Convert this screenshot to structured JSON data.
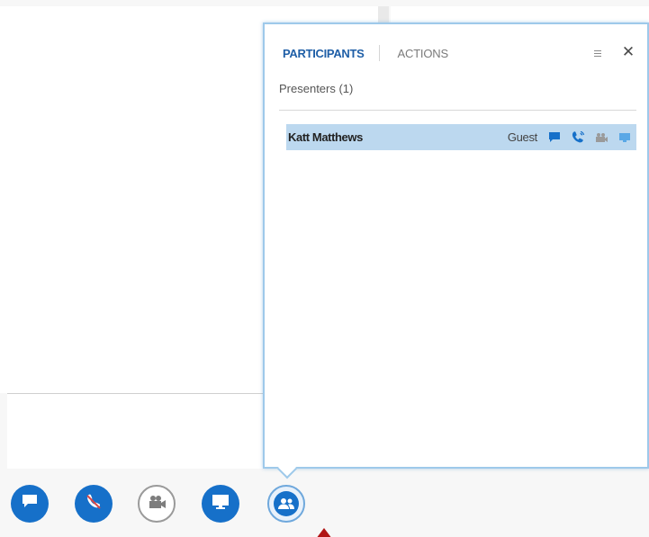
{
  "panel": {
    "tabs": [
      {
        "label": "PARTICIPANTS",
        "active": true
      },
      {
        "label": "ACTIONS",
        "active": false
      }
    ],
    "menu_icon": "hamburger-icon",
    "close_label": "✕",
    "heading": "Presenters (1)",
    "participants": [
      {
        "name": "Katt Matthews",
        "role": "Guest",
        "icons": [
          "im-icon",
          "audio-phone-icon",
          "video-icon",
          "sharing-icon"
        ]
      }
    ]
  },
  "toolbar": {
    "buttons": [
      {
        "icon": "im-icon",
        "style": "filled"
      },
      {
        "icon": "phone-muted-icon",
        "style": "filled"
      },
      {
        "icon": "video-camera-icon",
        "style": "outline"
      },
      {
        "icon": "present-monitor-icon",
        "style": "filled"
      },
      {
        "icon": "participants-icon",
        "style": "selected"
      }
    ]
  },
  "colors": {
    "accent": "#1670c9",
    "tab_active": "#1f5fa7",
    "row_highlight": "#bcd8ef",
    "panel_border": "#9ec9ea",
    "arrow": "#b01515"
  }
}
